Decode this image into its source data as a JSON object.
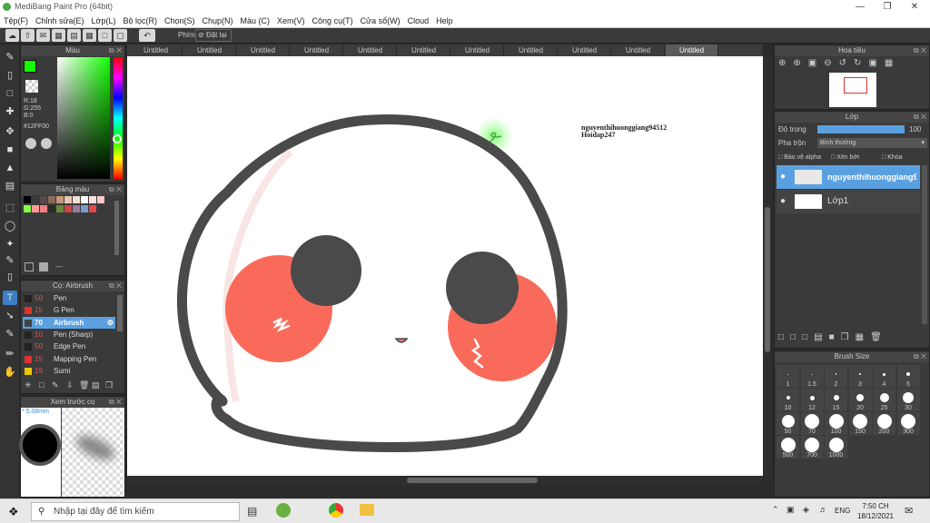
{
  "title": "MediBang Paint Pro (64bit)",
  "menu": [
    "Tệp(F)",
    "Chỉnh sửa(E)",
    "Lớp(L)",
    "Bộ lọc(R)",
    "Chọn(S)",
    "Chụp(N)",
    "Màu (C)",
    "Xem(V)",
    "Công cụ(T)",
    "Cửa sổ(W)",
    "Cloud",
    "Help"
  ],
  "toolbar": {
    "phim_label": "Phím",
    "reset_label": "Đặt lại"
  },
  "color_panel": {
    "title": "Màu",
    "r": "R:18",
    "g": "G:255",
    "b": "B:0",
    "hex": "#12FF00",
    "current_color": "#12ff00"
  },
  "palette_panel": {
    "title": "Bảng màu",
    "footer": "---",
    "swatches": [
      "#000000",
      "#3a3a3a",
      "#5a4a4a",
      "#8a6a5a",
      "#c49a7a",
      "#e8c8b0",
      "#f4e0d0",
      "#ffffff",
      "#ffe0e0",
      "#ffc8c8",
      "#88ff44",
      "#ff9999",
      "#f08080",
      "#2a2a2a",
      "#6a8a3a",
      "#cc4444",
      "#9a7a9a",
      "#7a9acc",
      "#e84848"
    ]
  },
  "brush_panel": {
    "title": "Cọ: Airbrush",
    "items": [
      {
        "size": "50",
        "name": "Pen",
        "color": "#222222"
      },
      {
        "size": "15",
        "name": "G Pen",
        "color": "#e03030"
      },
      {
        "size": "70",
        "name": "Airbrush",
        "color": "#444444"
      },
      {
        "size": "10",
        "name": "Pen (Sharp)",
        "color": "#222222"
      },
      {
        "size": "50",
        "name": "Edge Pen",
        "color": "#222222"
      },
      {
        "size": "15",
        "name": "Mapping Pen",
        "color": "#e03030"
      },
      {
        "size": "19",
        "name": "Sumi",
        "color": "#e8c800"
      }
    ]
  },
  "preview_panel": {
    "title": "Xem trước cọ",
    "size": "* 5.08mm"
  },
  "tabs": [
    "Untitled",
    "Untitled",
    "Untitled",
    "Untitled",
    "Untitled",
    "Untitled",
    "Untitled",
    "Untitled",
    "Untitled",
    "Untitled",
    "Untitled"
  ],
  "canvas": {
    "watermark_line1": "nguyenthihuonggiang94512",
    "watermark_line2": "Hoidap247"
  },
  "navigator": {
    "title": "Hoa tiêu"
  },
  "layer_panel": {
    "title": "Lớp",
    "opacity_label": "Độ trong",
    "opacity_value": "100 %",
    "blend_label": "Pha trộn",
    "blend_value": "Bình thường",
    "protect_alpha": "Bảo vệ alpha",
    "clipping": "Xén bớt",
    "lock": "Khóa",
    "layers": [
      {
        "name": "nguyenthihuonggiang94512",
        "selected": true
      },
      {
        "name": "Lớp1",
        "selected": false
      }
    ]
  },
  "brush_size_panel": {
    "title": "Brush Size",
    "sizes": [
      "1",
      "1.5",
      "2",
      "3",
      "4",
      "5",
      "10",
      "12",
      "15",
      "20",
      "25",
      "30",
      "50",
      "70",
      "100",
      "150",
      "200",
      "300",
      "500",
      "700",
      "1000"
    ]
  },
  "taskbar": {
    "search_placeholder": "Nhập tại đây để tìm kiếm",
    "language": "ENG",
    "time": "7:50 CH",
    "date": "18/12/2021"
  }
}
